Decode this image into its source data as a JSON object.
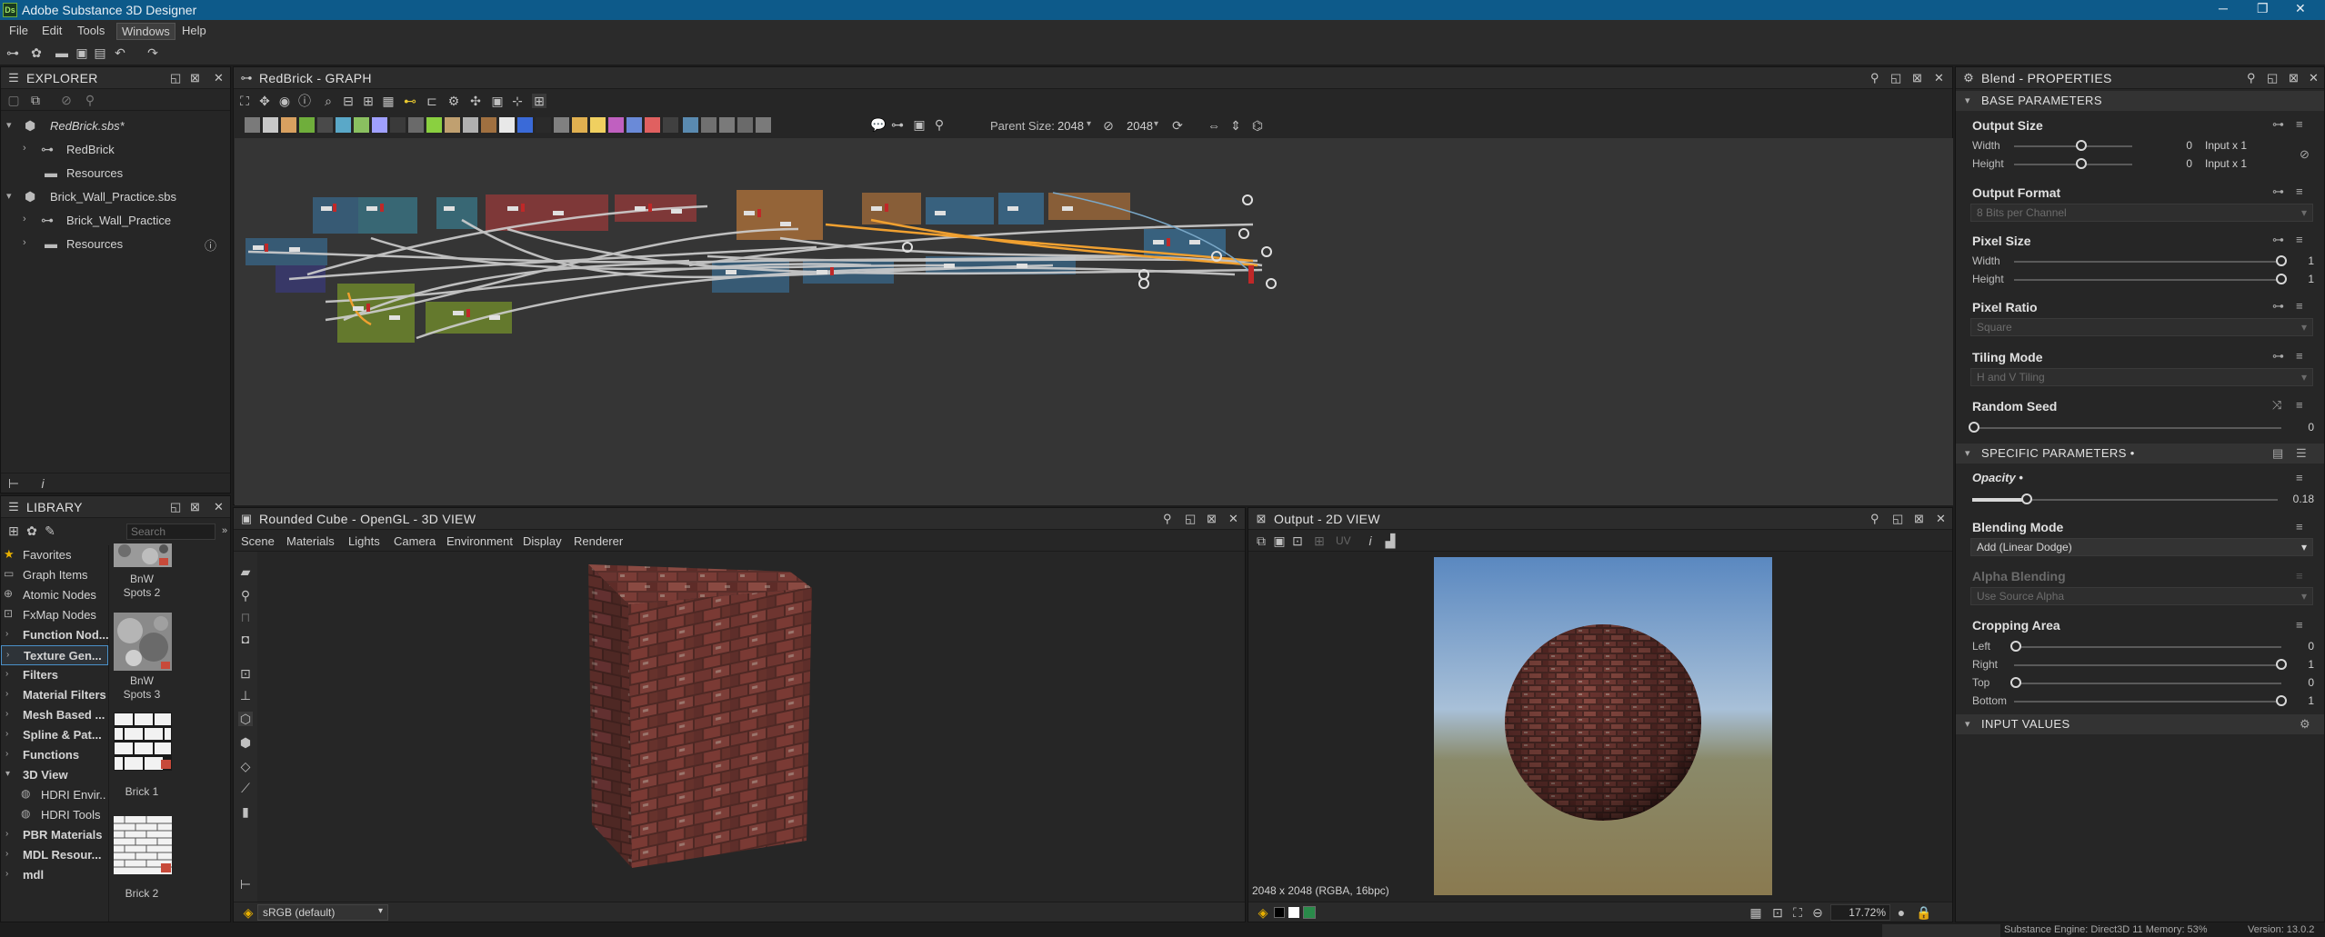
{
  "app": {
    "title": "Adobe Substance 3D Designer",
    "logo_text": "Ds"
  },
  "menu": [
    "File",
    "Edit",
    "Tools",
    "Windows",
    "Help"
  ],
  "explorer": {
    "title": "EXPLORER",
    "items": [
      {
        "label": "RedBrick.sbs*",
        "level": 0,
        "italic": true
      },
      {
        "label": "RedBrick",
        "level": 1
      },
      {
        "label": "Resources",
        "level": 1
      },
      {
        "label": "Brick_Wall_Practice.sbs",
        "level": 0
      },
      {
        "label": "Brick_Wall_Practice",
        "level": 1
      },
      {
        "label": "Resources",
        "level": 1
      }
    ]
  },
  "library": {
    "title": "LIBRARY",
    "search_placeholder": "Search",
    "categories": [
      {
        "label": "Favorites",
        "icon": "star-icon",
        "bold": false
      },
      {
        "label": "Graph Items",
        "bold": false
      },
      {
        "label": "Atomic Nodes",
        "bold": false
      },
      {
        "label": "FxMap Nodes",
        "bold": false
      },
      {
        "label": "Function Nod...",
        "bold": true
      },
      {
        "label": "Texture Gen...",
        "bold": true,
        "selected": true
      },
      {
        "label": "Filters",
        "bold": true
      },
      {
        "label": "Material Filters",
        "bold": true
      },
      {
        "label": "Mesh Based ...",
        "bold": true
      },
      {
        "label": "Spline & Pat...",
        "bold": true
      },
      {
        "label": "Functions",
        "bold": true
      },
      {
        "label": "3D View",
        "bold": true,
        "expanded": true
      },
      {
        "label": "HDRI Envir...",
        "bold": false,
        "child": true
      },
      {
        "label": "HDRI Tools",
        "bold": false,
        "child": true
      },
      {
        "label": "PBR Materials",
        "bold": true
      },
      {
        "label": "MDL Resour...",
        "bold": true
      },
      {
        "label": "mdl",
        "bold": true
      }
    ],
    "thumbnails": [
      {
        "label1": "BnW",
        "label2": "Spots 2"
      },
      {
        "label1": "BnW",
        "label2": "Spots 3"
      },
      {
        "label1": "Brick 1",
        "label2": ""
      },
      {
        "label1": "Brick 2",
        "label2": ""
      }
    ]
  },
  "graph": {
    "title": "RedBrick - GRAPH",
    "parent_size_label": "Parent Size:",
    "parent_size": "2048",
    "size": "2048"
  },
  "view3d": {
    "title": "Rounded Cube - OpenGL - 3D VIEW",
    "menu": [
      "Scene",
      "Materials",
      "Lights",
      "Camera",
      "Environment",
      "Display",
      "Renderer"
    ],
    "colorspace": "sRGB (default)"
  },
  "view2d": {
    "title": "Output - 2D VIEW",
    "uv_label": "UV",
    "info": "2048 x 2048 (RGBA, 16bpc)",
    "zoom": "17.72%"
  },
  "properties": {
    "title": "Blend - PROPERTIES",
    "base_header": "BASE PARAMETERS",
    "output_size": {
      "label": "Output Size",
      "width_label": "Width",
      "height_label": "Height",
      "width_value": "0",
      "height_value": "0",
      "width_mode": "Input x 1",
      "height_mode": "Input x 1"
    },
    "output_format": {
      "label": "Output Format",
      "value": "8 Bits per Channel"
    },
    "pixel_size": {
      "label": "Pixel Size",
      "width_label": "Width",
      "height_label": "Height",
      "width_value": "1",
      "height_value": "1"
    },
    "pixel_ratio": {
      "label": "Pixel Ratio",
      "value": "Square"
    },
    "tiling_mode": {
      "label": "Tiling Mode",
      "value": "H and V Tiling"
    },
    "random_seed": {
      "label": "Random Seed",
      "value": "0"
    },
    "specific_header": "SPECIFIC PARAMETERS •",
    "opacity": {
      "label": "Opacity •",
      "value": "0.18",
      "fraction": 0.18
    },
    "blending_mode": {
      "label": "Blending Mode",
      "value": "Add (Linear Dodge)"
    },
    "alpha_blending": {
      "label": "Alpha Blending",
      "value": "Use Source Alpha"
    },
    "cropping": {
      "label": "Cropping Area",
      "left_label": "Left",
      "right_label": "Right",
      "top_label": "Top",
      "bottom_label": "Bottom",
      "left": "0",
      "right": "1",
      "top": "0",
      "bottom": "1"
    },
    "input_header": "INPUT VALUES"
  },
  "status": {
    "text": "Substance Engine: Direct3D 11  Memory: 53%",
    "version": "Version: 13.0.2"
  },
  "colors": {
    "accent": "#0d5a8a",
    "orange_link": "#f0a030"
  }
}
